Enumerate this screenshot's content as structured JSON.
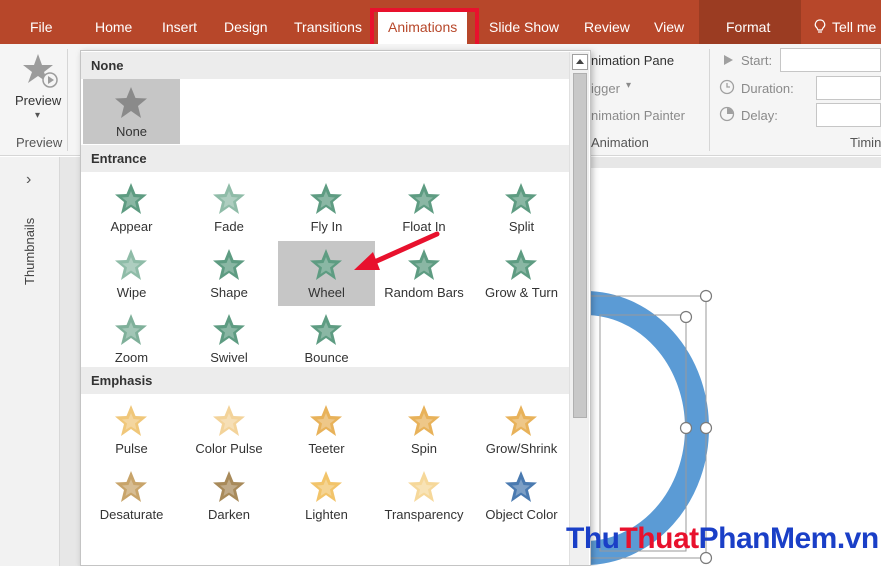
{
  "colors": {
    "accent": "#b7472a",
    "highlight": "#e8112d",
    "star_green": "#5e9c82",
    "star_gold": "#e8b25a"
  },
  "tabs": {
    "file": "File",
    "home": "Home",
    "insert": "Insert",
    "design": "Design",
    "transitions": "Transitions",
    "animations": "Animations",
    "slide_show": "Slide Show",
    "review": "Review",
    "view": "View",
    "format": "Format",
    "tell_me": "Tell me"
  },
  "ribbon": {
    "preview_label": "Preview",
    "preview_group": "Preview",
    "animation_pane": "nimation Pane",
    "trigger": "igger",
    "animation_painter": "nimation Painter",
    "animation_group": "Animation",
    "start": "Start:",
    "duration": "Duration:",
    "delay": "Delay:",
    "timing_group": "Timin"
  },
  "left": {
    "thumbnails": "Thumbnails",
    "expand": "›"
  },
  "gallery": {
    "none_section": "None",
    "none_item": "None",
    "entrance_section": "Entrance",
    "emphasis_section": "Emphasis",
    "entrance": [
      "Appear",
      "Fade",
      "Fly In",
      "Float In",
      "Split",
      "Wipe",
      "Shape",
      "Wheel",
      "Random Bars",
      "Grow & Turn",
      "Zoom",
      "Swivel",
      "Bounce"
    ],
    "emphasis": [
      "Pulse",
      "Color Pulse",
      "Teeter",
      "Spin",
      "Grow/Shrink",
      "Desaturate",
      "Darken",
      "Lighten",
      "Transparency",
      "Object Color"
    ],
    "selected": "Wheel"
  },
  "watermark": {
    "part1": "Thu",
    "part2": "Thuat",
    "part3": "PhanMem",
    "part4": ".vn"
  }
}
